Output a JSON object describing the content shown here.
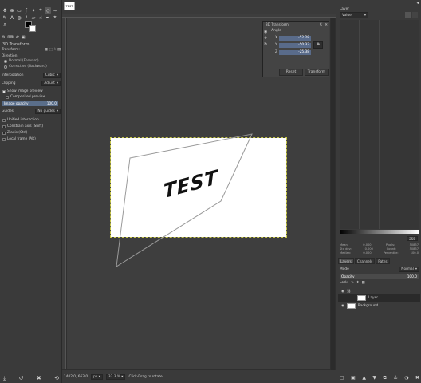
{
  "image_tab": {
    "label": "TEST"
  },
  "canvas": {
    "text": "TEST"
  },
  "tool_options": {
    "title": "3D Transform",
    "transform_label": "Transform:",
    "direction_label": "Direction",
    "direction_normal": "Normal (Forward)",
    "direction_corrective": "Corrective (Backward)",
    "interpolation_label": "Interpolation",
    "interpolation_value": "Cubic",
    "clipping_label": "Clipping",
    "clipping_value": "Adjust",
    "show_preview": "Show image preview",
    "composited_preview": "Composited preview",
    "image_opacity_label": "Image opacity",
    "image_opacity_value": "100.0",
    "guides_label": "Guides",
    "guides_value": "No guides",
    "unified": "Unified interaction",
    "constrain": "Constrain axis (Shift)",
    "z_axis": "Z axis (Ctrl)",
    "local_frame": "Local frame (Alt)"
  },
  "dialog": {
    "title": "3D Transform",
    "angle_label": "Angle",
    "x_label": "X",
    "x_value": "-52.28",
    "y_label": "Y",
    "y_value": "-50.33",
    "z_label": "Z",
    "z_value": "-25.38",
    "reset_label": "Reset",
    "transform_label": "Transform"
  },
  "status": {
    "coords": "1402.0, 663.0",
    "unit": "px",
    "zoom": "33.3 %",
    "message": "Click-Drag to rotate"
  },
  "histogram": {
    "panel_label": "Layer",
    "channel": "Value",
    "range_max": "255",
    "stats": [
      [
        "Mean:",
        "0.000",
        "Pixels:",
        "50837"
      ],
      [
        "Std dev:",
        "0.000",
        "Count:",
        "50837"
      ],
      [
        "Median:",
        "0.000",
        "Percentile:",
        "100.0"
      ]
    ]
  },
  "layers": {
    "tabs": [
      "Layers",
      "Channels",
      "Paths"
    ],
    "mode_label": "Mode",
    "mode_value": "Normal",
    "opacity_label": "Opacity",
    "opacity_value": "100.0",
    "lock_label": "Lock:",
    "items": [
      {
        "name": "Layer",
        "selected": true
      },
      {
        "name": "Background",
        "selected": false
      }
    ]
  }
}
